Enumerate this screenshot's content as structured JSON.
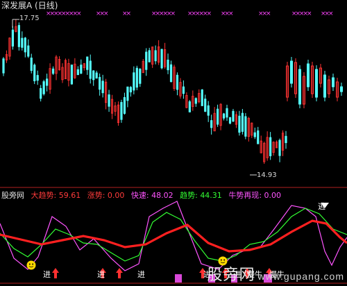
{
  "chart": {
    "title": "深发展A (日线)",
    "high_label": "17.75",
    "low_label": "14.93",
    "signal_marker": "×"
  },
  "indicator": {
    "name": "股旁网",
    "items": [
      {
        "label": "大趋势",
        "value": "59.61",
        "color": "#ff3b3b"
      },
      {
        "label": "涨势",
        "value": "0.00",
        "color": "#ff3b3b"
      },
      {
        "label": "快速",
        "value": "48.02",
        "color": "#ff55ff"
      },
      {
        "label": "趋势",
        "value": "44.31",
        "color": "#33ff33"
      },
      {
        "label": "牛势再现",
        "value": "0.00",
        "color": "#ff55ff"
      }
    ],
    "signals": [
      {
        "text": "进"
      },
      {
        "text": "进"
      },
      {
        "text": "进"
      },
      {
        "text": "进"
      },
      {
        "text": "进"
      },
      {
        "text": "慢牛"
      },
      {
        "text": "慢牛"
      },
      {
        "text": "逃"
      }
    ]
  },
  "watermark": {
    "main": "股旁网",
    "url": "www.gupang.com"
  },
  "chart_data": {
    "type": "candlestick",
    "price_max": 17.75,
    "price_min": 14.93,
    "indicators": {
      "大趋势": 59.61,
      "涨势": 0.0,
      "快速": 48.02,
      "趋势": 44.31,
      "牛势再现": 0.0
    }
  }
}
